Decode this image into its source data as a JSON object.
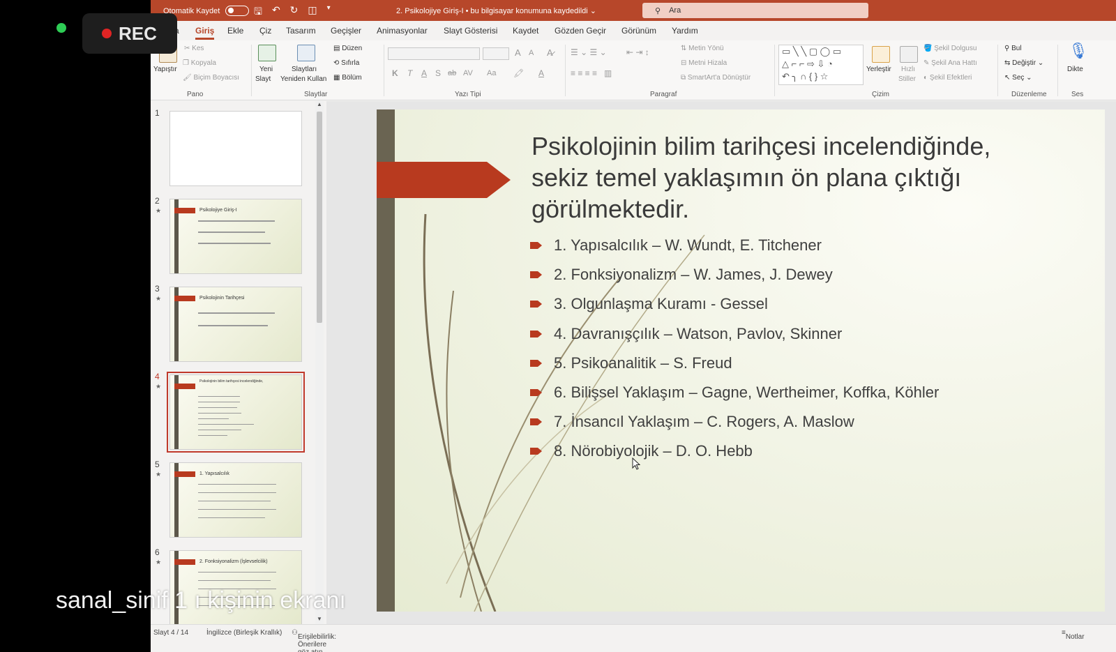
{
  "overlay": {
    "rec_label": "REC",
    "caption": "sanal_sinif 1      ı kişinin ekranı"
  },
  "titlebar": {
    "autosave_label": "Otomatik Kaydet",
    "doc_title": "2. Psikolojiye Giriş-I  •  bu bilgisayar konumuna kaydedildi",
    "search_placeholder": "Ara"
  },
  "tabs": [
    {
      "label": "a"
    },
    {
      "label": "Giriş"
    },
    {
      "label": "Ekle"
    },
    {
      "label": "Çiz"
    },
    {
      "label": "Tasarım"
    },
    {
      "label": "Geçişler"
    },
    {
      "label": "Animasyonlar"
    },
    {
      "label": "Slayt Gösterisi"
    },
    {
      "label": "Kaydet"
    },
    {
      "label": "Gözden Geçir"
    },
    {
      "label": "Görünüm"
    },
    {
      "label": "Yardım"
    }
  ],
  "ribbon": {
    "pano": {
      "paste": "Yapıştır",
      "cut": "Kes",
      "copy": "Kopyala",
      "format_painter": "Biçim Boyacısı",
      "label": "Pano"
    },
    "slaytlar": {
      "new_slide": "Yeni",
      "new_slide2": "Slayt",
      "reuse": "Slaytları",
      "reuse2": "Yeniden Kullan",
      "layout": "Düzen",
      "reset": "Sıfırla",
      "section": "Bölüm",
      "label": "Slaytlar"
    },
    "font": {
      "bold": "K",
      "italic": "T",
      "underline": "A",
      "shadow": "S",
      "strike": "ab",
      "spacing": "AV",
      "case": "Aa",
      "grow": "A",
      "shrink": "A",
      "label": "Yazı Tipi"
    },
    "paragraph": {
      "text_direction": "Metin Yönü",
      "align_text": "Metni Hizala",
      "smartart": "SmartArt'a Dönüştür",
      "label": "Paragraf"
    },
    "drawing": {
      "arrange": "Yerleştir",
      "quick_styles": "Hızlı",
      "quick_styles2": "Stiller",
      "fill": "Şekil Dolgusu",
      "outline": "Şekil Ana Hattı",
      "effects": "Şekil Efektleri",
      "label": "Çizim"
    },
    "editing": {
      "find": "Bul",
      "replace": "Değiştir",
      "select": "Seç",
      "label": "Düzenleme"
    },
    "voice": {
      "dictate": "Dikte",
      "label": "Ses"
    }
  },
  "thumbnails": [
    {
      "num": "1",
      "title": ""
    },
    {
      "num": "2",
      "title": "Psikolojiye Giriş-I"
    },
    {
      "num": "3",
      "title": "Psikolojinin Tarihçesi"
    },
    {
      "num": "4",
      "title": "Psikolojinin bilim tarihçesi incelendiğinde,"
    },
    {
      "num": "5",
      "title": "1. Yapısalcılık"
    },
    {
      "num": "6",
      "title": "2. Fonksiyonalizm (İşlevselcilik)"
    }
  ],
  "slide": {
    "title_lines": [
      "Psikolojinin bilim tarihçesi incelendiğinde,",
      "sekiz temel yaklaşımın ön plana çıktığı",
      "görülmektedir."
    ],
    "bullets": [
      "1. Yapısalcılık – W. Wundt, E. Titchener",
      "2. Fonksiyonalizm – W. James, J. Dewey",
      "3. Olgunlaşma Kuramı - Gessel",
      "4. Davranışçılık – Watson,  Pavlov, Skinner",
      "5. Psikoanalitik – S. Freud",
      "6. Bilişsel Yaklaşım – Gagne, Wertheimer, Koffka, Köhler",
      "7. İnsancıl Yaklaşım – C. Rogers, A. Maslow",
      "8. Nörobiyolojik – D. O. Hebb"
    ]
  },
  "status": {
    "slide_counter": "Slayt 4 / 14",
    "language": "İngilizce (Birleşik Krallık)",
    "accessibility": "Erişilebilirlik: Önerilere göz atın",
    "notes": "Notlar"
  },
  "colors": {
    "accent": "#b7472a",
    "arrow": "#b83a1f"
  }
}
